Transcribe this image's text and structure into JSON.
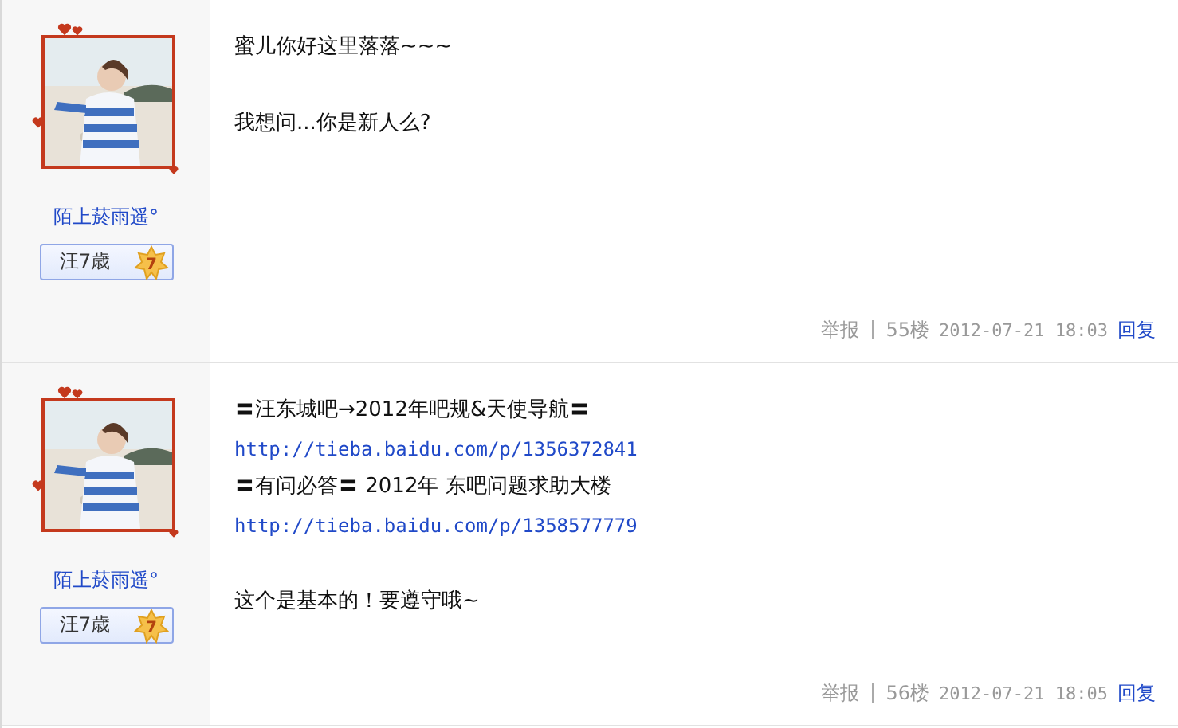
{
  "posts": [
    {
      "author": {
        "name": "陌上菸雨遥°",
        "badge": "汪7歳",
        "level": "7"
      },
      "lines": [
        {
          "kind": "text",
          "text": "蜜儿你好这里落落~~~"
        },
        {
          "kind": "break"
        },
        {
          "kind": "text",
          "text": "我想问...你是新人么?"
        }
      ],
      "footer": {
        "report": "举报",
        "floor": "55楼",
        "time": "2012-07-21 18:03",
        "reply": "回复"
      }
    },
    {
      "author": {
        "name": "陌上菸雨遥°",
        "badge": "汪7歳",
        "level": "7"
      },
      "lines": [
        {
          "kind": "text",
          "text": "〓汪东城吧→2012年吧规&天使导航〓"
        },
        {
          "kind": "link",
          "text": "http://tieba.baidu.com/p/1356372841"
        },
        {
          "kind": "text",
          "text": "〓有问必答〓 2012年 东吧问题求助大楼"
        },
        {
          "kind": "link",
          "text": "http://tieba.baidu.com/p/1358577779"
        },
        {
          "kind": "break"
        },
        {
          "kind": "text",
          "text": "这个是基本的！要遵守哦~"
        }
      ],
      "footer": {
        "report": "举报",
        "floor": "56楼",
        "time": "2012-07-21 18:05",
        "reply": "回复"
      }
    }
  ]
}
